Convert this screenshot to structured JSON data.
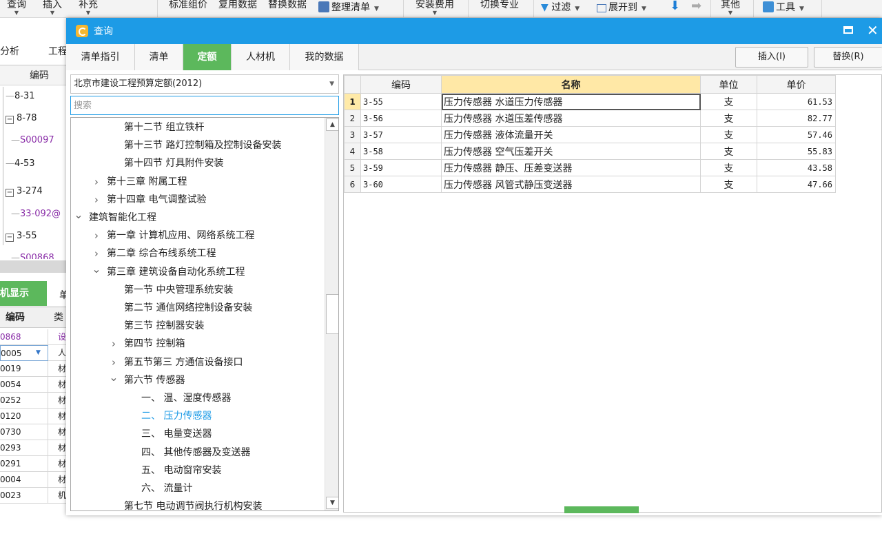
{
  "toolbar": {
    "items": [
      "查询",
      "插入",
      "补充",
      "标准组价",
      "复用数据",
      "替换数据",
      "整理清单",
      "安装费用",
      "切换专业",
      "过滤",
      "展开到",
      "其他",
      "工具"
    ]
  },
  "bg_panel": {
    "tabs": [
      "分析",
      "工程"
    ],
    "code_header": "编码",
    "rows": [
      "8-31",
      "8-78",
      "S00097",
      "4-53",
      "3-274",
      "33-092@",
      "3-55",
      "S00868"
    ],
    "sub_tabs": [
      "机显示",
      "单"
    ],
    "grid_headers": [
      "编码",
      "类"
    ],
    "grid_rows": [
      {
        "code": "0868",
        "type": "设"
      },
      {
        "code": "0005",
        "type": "人"
      },
      {
        "code": "0019",
        "type": "材"
      },
      {
        "code": "0054",
        "type": "材"
      },
      {
        "code": "0252",
        "type": "材"
      },
      {
        "code": "0120",
        "type": "材"
      },
      {
        "code": "0730",
        "type": "材"
      },
      {
        "code": "0293",
        "type": "材"
      },
      {
        "code": "0291",
        "type": "材"
      },
      {
        "code": "0004",
        "type": "材"
      },
      {
        "code": "0023",
        "type": "机"
      }
    ]
  },
  "dialog": {
    "title": "查询",
    "tabs": [
      "清单指引",
      "清单",
      "定额",
      "人材机",
      "我的数据"
    ],
    "active_tab": "定额",
    "insert_label": "插入(I)",
    "replace_label": "替换(R)",
    "library": "北京市建设工程预算定额(2012)",
    "search_placeholder": "搜索",
    "tree": [
      {
        "label": "第十二节 组立铁杆"
      },
      {
        "label": "第十三节 路灯控制箱及控制设备安装"
      },
      {
        "label": "第十四节 灯具附件安装"
      },
      {
        "label": "第十三章 附属工程"
      },
      {
        "label": "第十四章 电气调整试验"
      },
      {
        "label": "建筑智能化工程"
      },
      {
        "label": "第一章 计算机应用、网络系统工程"
      },
      {
        "label": "第二章 综合布线系统工程"
      },
      {
        "label": "第三章 建筑设备自动化系统工程"
      },
      {
        "label": "第一节 中央管理系统安装"
      },
      {
        "label": "第二节 通信网络控制设备安装"
      },
      {
        "label": "第三节 控制器安装"
      },
      {
        "label": "第四节 控制箱"
      },
      {
        "label": "第五节第三 方通信设备接口"
      },
      {
        "label": "第六节 传感器"
      },
      {
        "label": "一、 温、湿度传感器"
      },
      {
        "label": "二、 压力传感器"
      },
      {
        "label": "三、 电量变送器"
      },
      {
        "label": "四、 其他传感器及变送器"
      },
      {
        "label": "五、 电动窗帘安装"
      },
      {
        "label": "六、 流量计"
      },
      {
        "label": "第七节 电动调节阀执行机构安装"
      }
    ],
    "table": {
      "headers": [
        "编码",
        "名称",
        "单位",
        "单价"
      ],
      "rows": [
        {
          "idx": "1",
          "code": "3-55",
          "name": "压力传感器 水道压力传感器",
          "unit": "支",
          "price": "61.53"
        },
        {
          "idx": "2",
          "code": "3-56",
          "name": "压力传感器 水道压差传感器",
          "unit": "支",
          "price": "82.77"
        },
        {
          "idx": "3",
          "code": "3-57",
          "name": "压力传感器 液体流量开关",
          "unit": "支",
          "price": "57.46"
        },
        {
          "idx": "4",
          "code": "3-58",
          "name": "压力传感器 空气压差开关",
          "unit": "支",
          "price": "55.83"
        },
        {
          "idx": "5",
          "code": "3-59",
          "name": "压力传感器 静压、压差变送器",
          "unit": "支",
          "price": "43.58"
        },
        {
          "idx": "6",
          "code": "3-60",
          "name": "压力传感器 风管式静压变送器",
          "unit": "支",
          "price": "47.66"
        }
      ]
    }
  },
  "colors": {
    "title_bar": "#1d9be6",
    "active_tab": "#5cb85c",
    "selected_tree": "#1d9be6",
    "header_highlight": "#ffe8a6"
  }
}
